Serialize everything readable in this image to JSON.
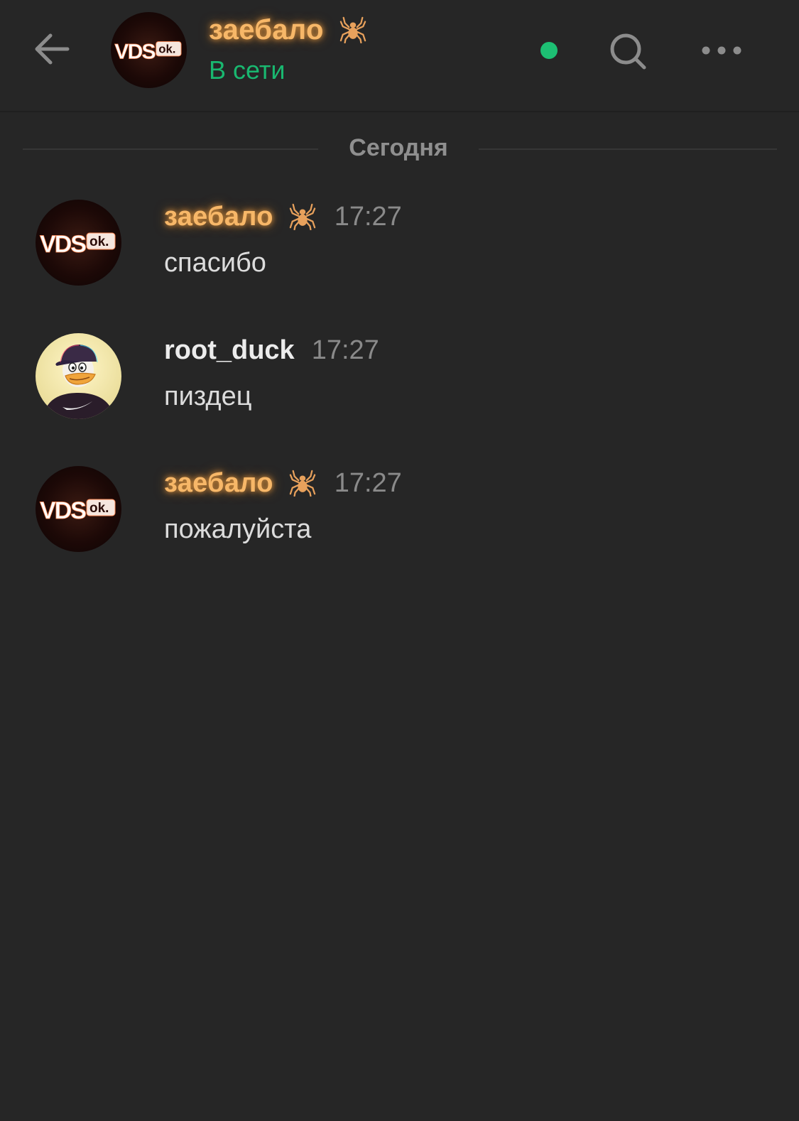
{
  "header": {
    "back_icon": "arrow-left-icon",
    "contact_name": "заебало",
    "contact_badge_icon": "spider-icon",
    "status": "В сети",
    "online_indicator_color": "#1dbf73",
    "search_icon": "search-icon",
    "more_icon": "more-horizontal-icon"
  },
  "date_divider": {
    "label": "Сегодня"
  },
  "messages": [
    {
      "author": "заебало",
      "author_style": "glow-orange",
      "badge_icon": "spider-icon",
      "time": "17:27",
      "text": "спасибо",
      "avatar_text": "VDS",
      "avatar_badge": "ok."
    },
    {
      "author": "root_duck",
      "author_style": "plain",
      "time": "17:27",
      "text": "пиздец",
      "avatar_icon": "duck-avatar"
    },
    {
      "author": "заебало",
      "author_style": "glow-orange",
      "badge_icon": "spider-icon",
      "time": "17:27",
      "text": "пожалуйста",
      "avatar_text": "VDS",
      "avatar_badge": "ok."
    }
  ],
  "colors": {
    "background": "#262626",
    "accent_green": "#19b870",
    "name_glow": "#f7b768"
  }
}
